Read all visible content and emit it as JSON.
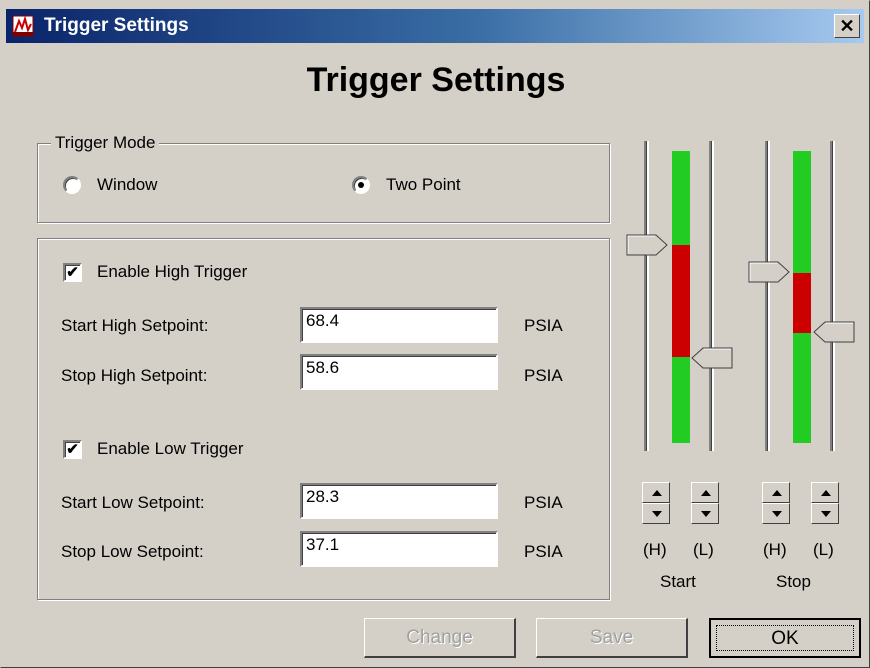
{
  "window": {
    "title": "Trigger Settings",
    "close_glyph": "✕"
  },
  "heading": "Trigger Settings",
  "trigger_mode": {
    "legend": "Trigger Mode",
    "options": [
      {
        "label": "Window",
        "selected": false
      },
      {
        "label": "Two Point",
        "selected": true
      }
    ]
  },
  "high_trigger": {
    "enable_label": "Enable High Trigger",
    "checked": true,
    "rows": [
      {
        "label": "Start High Setpoint:",
        "value": "68.4",
        "unit": "PSIA"
      },
      {
        "label": "Stop High Setpoint:",
        "value": "58.6",
        "unit": "PSIA"
      }
    ]
  },
  "low_trigger": {
    "enable_label": "Enable Low Trigger",
    "checked": true,
    "rows": [
      {
        "label": "Start Low Setpoint:",
        "value": "28.3",
        "unit": "PSIA"
      },
      {
        "label": "Stop Low Setpoint:",
        "value": "37.1",
        "unit": "PSIA"
      }
    ]
  },
  "sliders": {
    "start": {
      "label": "Start",
      "high_label": "(H)",
      "low_label": "(L)"
    },
    "stop": {
      "label": "Stop",
      "high_label": "(H)",
      "low_label": "(L)"
    }
  },
  "colors": {
    "in_band": "#cc0000",
    "out_band": "#22cc22",
    "title_bar": "#0a246a"
  },
  "buttons": {
    "change": {
      "label": "Change",
      "enabled": false
    },
    "save": {
      "label": "Save",
      "enabled": false
    },
    "ok": {
      "label": "OK",
      "enabled": true
    }
  },
  "icons": [
    "app-icon",
    "close-icon",
    "spin-up-icon",
    "spin-down-icon"
  ]
}
